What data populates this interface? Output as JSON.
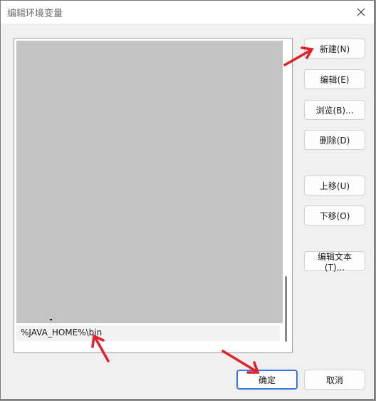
{
  "window": {
    "title": "编辑环境变量"
  },
  "list": {
    "items": [
      "%JAVA_HOME%\\bin"
    ]
  },
  "buttons": {
    "new": "新建(N)",
    "edit": "编辑(E)",
    "browse": "浏览(B)...",
    "delete": "删除(D)",
    "move_up": "上移(U)",
    "move_down": "下移(O)",
    "edit_text": "编辑文本(T)...",
    "ok": "确定",
    "cancel": "取消"
  },
  "colors": {
    "annotation_arrow": "#e0202a",
    "ok_focus": "#3c78d8"
  }
}
